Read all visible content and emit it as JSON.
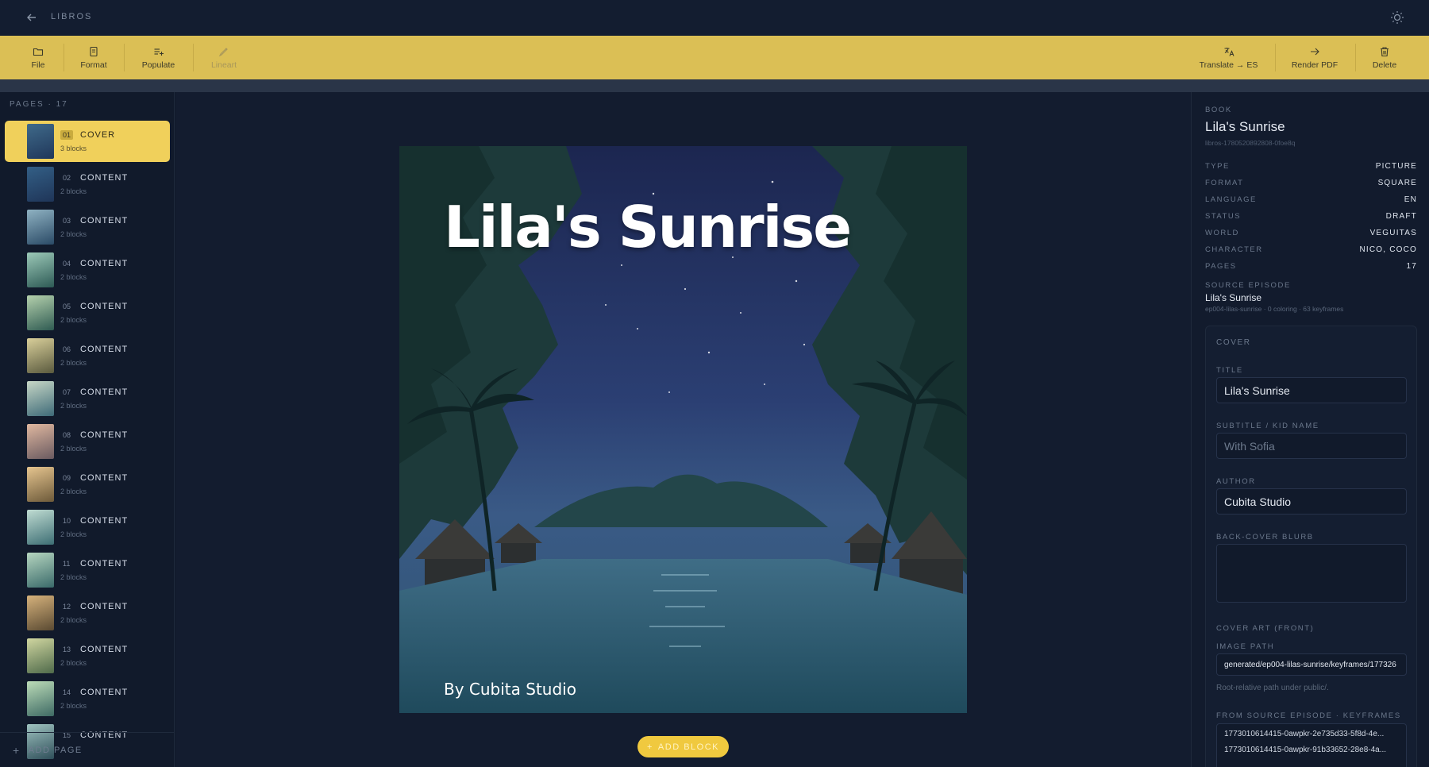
{
  "topbar": {
    "app_name": "LIBROS"
  },
  "toolbar": {
    "file": "File",
    "format": "Format",
    "populate": "Populate",
    "lineart": "Lineart",
    "translate": "Translate → ES",
    "render_pdf": "Render PDF",
    "delete": "Delete"
  },
  "sidebar": {
    "pages_label": "PAGES · 17",
    "add_page": "ADD PAGE",
    "pages": [
      {
        "num": "01",
        "type": "COVER",
        "blocks": "3 blocks"
      },
      {
        "num": "02",
        "type": "CONTENT",
        "blocks": "2 blocks"
      },
      {
        "num": "03",
        "type": "CONTENT",
        "blocks": "2 blocks"
      },
      {
        "num": "04",
        "type": "CONTENT",
        "blocks": "2 blocks"
      },
      {
        "num": "05",
        "type": "CONTENT",
        "blocks": "2 blocks"
      },
      {
        "num": "06",
        "type": "CONTENT",
        "blocks": "2 blocks"
      },
      {
        "num": "07",
        "type": "CONTENT",
        "blocks": "2 blocks"
      },
      {
        "num": "08",
        "type": "CONTENT",
        "blocks": "2 blocks"
      },
      {
        "num": "09",
        "type": "CONTENT",
        "blocks": "2 blocks"
      },
      {
        "num": "10",
        "type": "CONTENT",
        "blocks": "2 blocks"
      },
      {
        "num": "11",
        "type": "CONTENT",
        "blocks": "2 blocks"
      },
      {
        "num": "12",
        "type": "CONTENT",
        "blocks": "2 blocks"
      },
      {
        "num": "13",
        "type": "CONTENT",
        "blocks": "2 blocks"
      },
      {
        "num": "14",
        "type": "CONTENT",
        "blocks": "2 blocks"
      },
      {
        "num": "15",
        "type": "CONTENT",
        "blocks": ""
      }
    ]
  },
  "canvas": {
    "cover_title": "Lila's Sunrise",
    "cover_author": "By Cubita Studio",
    "add_block": "ADD BLOCK"
  },
  "panel": {
    "book_label": "BOOK",
    "book_title": "Lila's Sunrise",
    "book_id": "libros-1780520892808-0foe8q",
    "meta": [
      {
        "key": "TYPE",
        "value": "PICTURE"
      },
      {
        "key": "FORMAT",
        "value": "SQUARE"
      },
      {
        "key": "LANGUAGE",
        "value": "EN"
      },
      {
        "key": "STATUS",
        "value": "DRAFT"
      },
      {
        "key": "WORLD",
        "value": "VEGUITAS"
      },
      {
        "key": "CHARACTER",
        "value": "NICO, COCO"
      },
      {
        "key": "PAGES",
        "value": "17"
      }
    ],
    "source_label": "SOURCE EPISODE",
    "source_title": "Lila's Sunrise",
    "source_sub": "ep004-lilas-sunrise · 0 coloring · 63 keyframes",
    "cover": {
      "heading": "COVER",
      "title_label": "TITLE",
      "title_value": "Lila's Sunrise",
      "subtitle_label": "SUBTITLE / KID NAME",
      "subtitle_placeholder": "With Sofia",
      "author_label": "AUTHOR",
      "author_value": "Cubita Studio",
      "blurb_label": "BACK-COVER BLURB",
      "art_label": "COVER ART (FRONT)",
      "image_path_label": "IMAGE PATH",
      "image_path_value": "generated/ep004-lilas-sunrise/keyframes/177326",
      "image_path_hint": "Root-relative path under public/.",
      "keyframes_label": "FROM SOURCE EPISODE · KEYFRAMES",
      "keyframes": [
        "1773010614415-0awpkr-2e735d33-5f8d-4e...",
        "1773010614415-0awpkr-91b33652-28e8-4a..."
      ]
    }
  }
}
